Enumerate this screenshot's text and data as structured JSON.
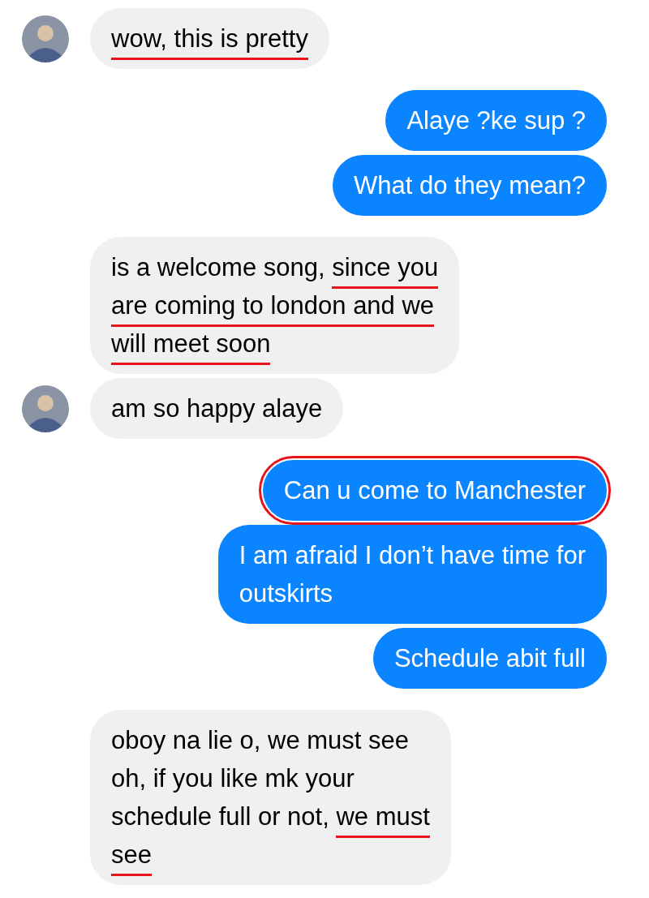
{
  "messages": [
    {
      "kind": "received",
      "avatar": true,
      "boxed": false,
      "parts": [
        {
          "text": "wow, this is pretty",
          "underlined": true
        }
      ]
    },
    {
      "kind": "sent",
      "boxed": false,
      "parts": [
        {
          "text": "Alaye ?ke sup ?",
          "underlined": false
        }
      ]
    },
    {
      "kind": "sent",
      "boxed": false,
      "parts": [
        {
          "text": "What do they mean?",
          "underlined": false
        }
      ]
    },
    {
      "kind": "received",
      "avatar": false,
      "boxed": false,
      "parts": [
        {
          "text": "is a welcome song, ",
          "underlined": false
        },
        {
          "text": "since you\nare coming to london and we\nwill meet soon",
          "underlined": true
        }
      ]
    },
    {
      "kind": "received",
      "avatar": true,
      "boxed": false,
      "parts": [
        {
          "text": "am so happy alaye",
          "underlined": false
        }
      ]
    },
    {
      "kind": "sent",
      "boxed": true,
      "parts": [
        {
          "text": "Can u come to Manchester",
          "underlined": false
        }
      ]
    },
    {
      "kind": "sent",
      "boxed": false,
      "parts": [
        {
          "text": "I am afraid I don’t have time for\noutskirts",
          "underlined": false
        }
      ]
    },
    {
      "kind": "sent",
      "boxed": false,
      "parts": [
        {
          "text": "Schedule abit full",
          "underlined": false
        }
      ]
    },
    {
      "kind": "received",
      "avatar": false,
      "boxed": false,
      "parts": [
        {
          "text": "oboy na lie o, we must see\noh, if you like mk your\nschedule full or not, ",
          "underlined": false
        },
        {
          "text": "we must\nsee ",
          "underlined": true
        }
      ]
    }
  ]
}
